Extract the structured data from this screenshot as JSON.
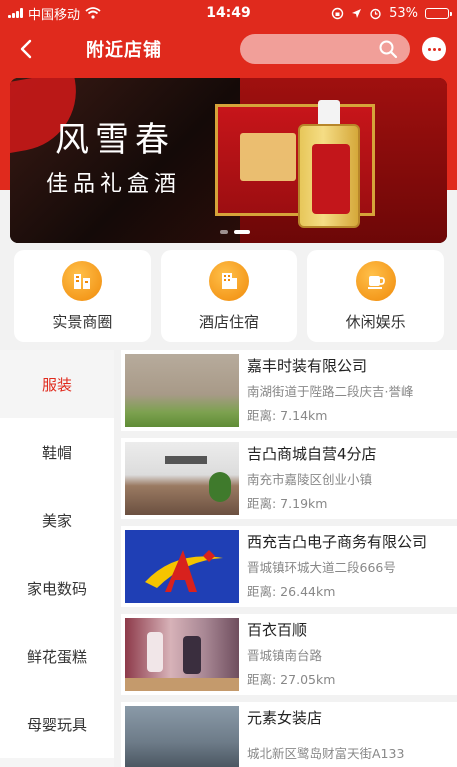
{
  "status_bar": {
    "carrier": "中国移动",
    "time": "14:49",
    "battery": "53%",
    "battery_level": 0.53
  },
  "nav": {
    "title": "附近店铺",
    "back_icon": "chevron-left-icon",
    "search_icon": "search-icon",
    "more_icon": "more-icon"
  },
  "banner": {
    "title": "风雪春",
    "subtitle": "佳品礼盒酒",
    "slide_count": 2,
    "active_slide": 1
  },
  "categories": [
    {
      "label": "实景商圈",
      "icon": "building-icon"
    },
    {
      "label": "酒店住宿",
      "icon": "hotel-icon"
    },
    {
      "label": "休闲娱乐",
      "icon": "cup-icon"
    }
  ],
  "sidebar": {
    "items": [
      {
        "label": "服装"
      },
      {
        "label": "鞋帽"
      },
      {
        "label": "美家"
      },
      {
        "label": "家电数码"
      },
      {
        "label": "鲜花蛋糕"
      },
      {
        "label": "母婴玩具"
      }
    ],
    "active": "服装"
  },
  "stores": [
    {
      "name": "嘉丰时装有限公司",
      "address": "南湖街道于陛路二段庆吉·誉峰",
      "distance": "距离:   7.14km"
    },
    {
      "name": "吉凸商城自营4分店",
      "address": "南充市嘉陵区创业小镇",
      "distance": "距离:   7.19km"
    },
    {
      "name": "西充吉凸电子商务有限公司",
      "address": "晋城镇环城大道二段666号",
      "distance": "距离:   26.44km"
    },
    {
      "name": "百衣百顺",
      "address": "晋城镇南台路",
      "distance": "距离:   27.05km"
    },
    {
      "name": "元素女装店",
      "address": "城北新区鹭岛财富天街A133",
      "distance": ""
    }
  ],
  "colors": {
    "brand_red": "#e02a1d",
    "category_orange": "#f08a0a"
  }
}
